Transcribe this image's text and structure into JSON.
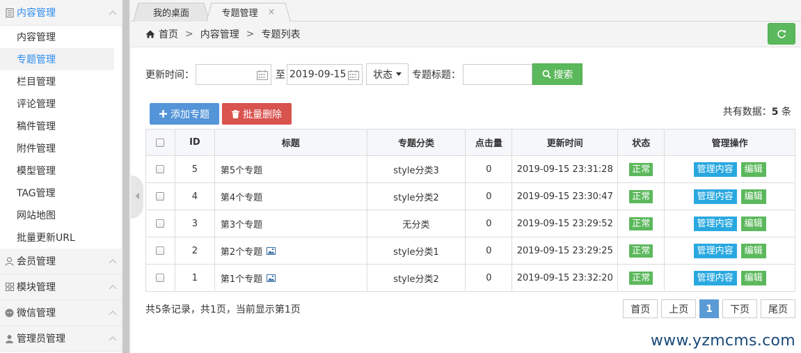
{
  "sidebar": {
    "groups": [
      {
        "label": "内容管理",
        "icon": "document-icon",
        "items": [
          "内容管理",
          "专题管理",
          "栏目管理",
          "评论管理",
          "稿件管理",
          "附件管理",
          "模型管理",
          "TAG管理",
          "网站地图",
          "批量更新URL"
        ]
      },
      {
        "label": "会员管理",
        "icon": "user-icon"
      },
      {
        "label": "模块管理",
        "icon": "grid-icon"
      },
      {
        "label": "微信管理",
        "icon": "wechat-icon"
      },
      {
        "label": "管理员管理",
        "icon": "admin-user-icon"
      }
    ],
    "active_item": "专题管理"
  },
  "tabs": [
    {
      "label": "我的桌面"
    },
    {
      "label": "专题管理",
      "close": "×"
    }
  ],
  "breadcrumb": {
    "home": "首页",
    "sep": ">",
    "level1": "内容管理",
    "level2": "专题列表"
  },
  "search": {
    "update_time_label": "更新时间：",
    "start_date": "",
    "to_label": "至",
    "end_date": "2019-09-15",
    "status_select": "状态",
    "title_label": "专题标题：",
    "title_value": "",
    "search_button": "搜索"
  },
  "actions": {
    "add": "添加专题",
    "batch_delete": "批量删除"
  },
  "total": {
    "prefix": "共有数据：",
    "count": "5",
    "suffix": " 条"
  },
  "table": {
    "headers": [
      "ID",
      "标题",
      "专题分类",
      "点击量",
      "更新时间",
      "状态",
      "管理操作"
    ],
    "rows": [
      {
        "id": "5",
        "title": "第5个专题",
        "has_image": false,
        "category": "style分类3",
        "clicks": "0",
        "updated": "2019-09-15 23:31:28",
        "status": "正常"
      },
      {
        "id": "4",
        "title": "第4个专题",
        "has_image": false,
        "category": "style分类2",
        "clicks": "0",
        "updated": "2019-09-15 23:30:47",
        "status": "正常"
      },
      {
        "id": "3",
        "title": "第3个专题",
        "has_image": false,
        "category": "无分类",
        "clicks": "0",
        "updated": "2019-09-15 23:29:52",
        "status": "正常"
      },
      {
        "id": "2",
        "title": "第2个专题",
        "has_image": true,
        "category": "style分类1",
        "clicks": "0",
        "updated": "2019-09-15 23:29:25",
        "status": "正常"
      },
      {
        "id": "1",
        "title": "第1个专题",
        "has_image": true,
        "category": "style分类2",
        "clicks": "0",
        "updated": "2019-09-15 23:32:20",
        "status": "正常"
      }
    ],
    "op_manage": "管理内容",
    "op_edit": "编辑"
  },
  "footer": {
    "record_info": "共5条记录，共1页，当前显示第1页",
    "pager": {
      "first": "首页",
      "prev": "上页",
      "current": "1",
      "next": "下页",
      "last": "尾页"
    }
  },
  "watermark": "www.yzmcms.com",
  "colors": {
    "accent": "#2d8cf0",
    "green": "#5cb85c",
    "red": "#d9534f",
    "blue": "#5494d8",
    "cyan": "#29a8e0"
  }
}
